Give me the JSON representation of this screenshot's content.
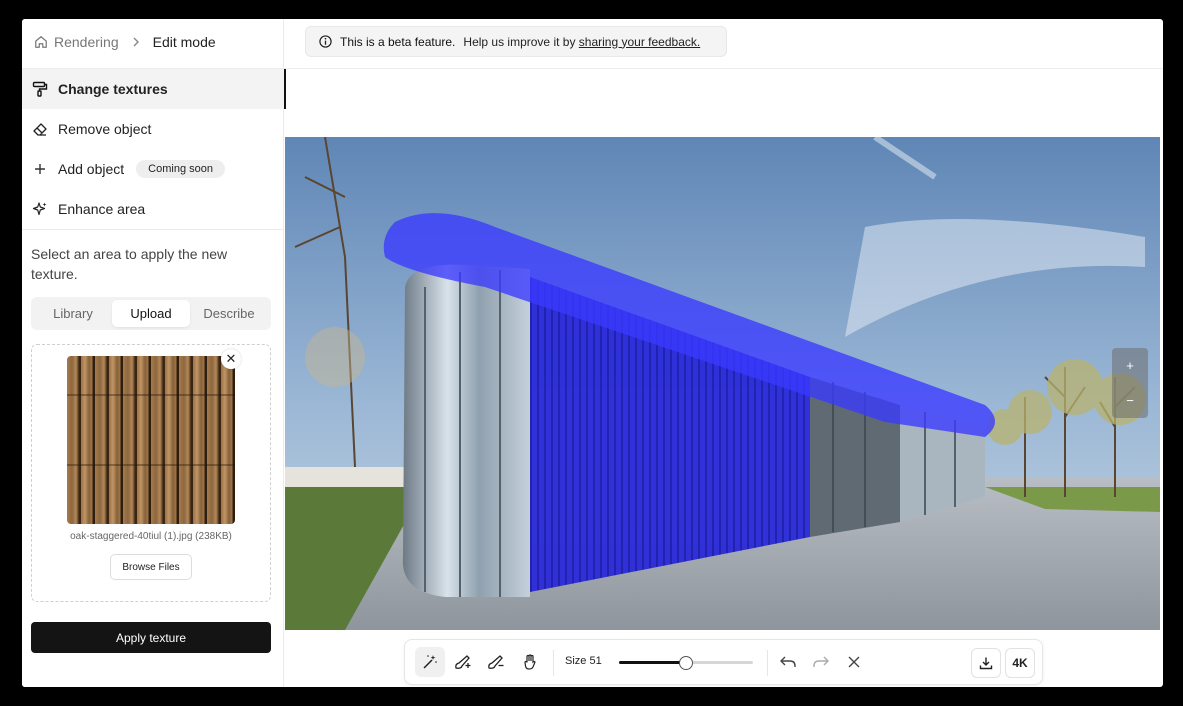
{
  "breadcrumb": {
    "root": "Rendering",
    "current": "Edit mode",
    "home_icon": "home-icon",
    "separator_icon": "chevron-right-icon"
  },
  "menu": {
    "items": [
      {
        "label": "Change textures",
        "icon": "paint-roller-icon",
        "active": true
      },
      {
        "label": "Remove object",
        "icon": "eraser-icon",
        "active": false
      },
      {
        "label": "Add object",
        "icon": "plus-icon",
        "active": false,
        "badge": "Coming soon"
      },
      {
        "label": "Enhance area",
        "icon": "sparkles-icon",
        "active": false
      }
    ]
  },
  "texture_panel": {
    "instructions": "Select an area to apply the new texture.",
    "tabs": [
      "Library",
      "Upload",
      "Describe"
    ],
    "selected_tab": "Upload",
    "file_name": "oak-staggered-40tiul (1).jpg (238KB)",
    "browse_label": "Browse Files",
    "apply_label": "Apply texture"
  },
  "banner": {
    "icon": "info-icon",
    "bold_text": "This is a beta feature.",
    "text": "Help us improve it by",
    "link_text": "sharing your feedback."
  },
  "canvas": {
    "image_description_icon": "rendered-building-image",
    "mask_color": "#3a3aff"
  },
  "zoom": {
    "in_label": "+",
    "out_label": "−"
  },
  "toolbar": {
    "tools": [
      "magic-wand-icon",
      "brush-add-icon",
      "brush-erase-icon",
      "pan-hand-icon"
    ],
    "active_tool": "magic-wand-icon",
    "size_label": "Size 51",
    "size_value": 51,
    "size_fraction": 0.5,
    "undo_icon": "undo-icon",
    "redo_icon": "redo-icon",
    "clear_icon": "close-icon",
    "download_icon": "download-icon",
    "resolution_label": "4K"
  },
  "colors": {
    "accent": "#111111",
    "mask": "#3a3aff",
    "badge_bg": "#eeeeee"
  }
}
